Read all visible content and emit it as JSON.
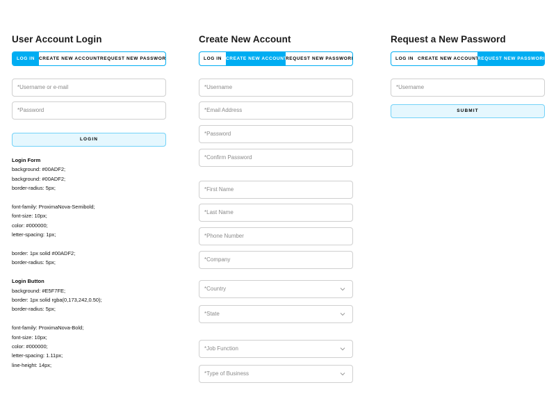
{
  "login": {
    "title": "User Account Login",
    "tabs": [
      "LOG IN",
      "CREATE NEW ACCOUNT",
      "REQUEST NEW PASSWORD"
    ],
    "active_tab": 0,
    "fields": {
      "username": "*Username or e-mail",
      "password": "*Password"
    },
    "button": "LOGIN",
    "notes": {
      "form_heading": "Login Form",
      "form_lines_1": [
        "background: #00ADF2;",
        "background: #00ADF2;",
        "border-radius: 5px;"
      ],
      "form_lines_2": [
        "font-family: ProximaNova-Semibold;",
        "font-size: 10px;",
        "color: #000000;",
        "letter-spacing: 1px;"
      ],
      "form_lines_3": [
        "border: 1px solid #00ADF2;",
        "border-radius: 5px;"
      ],
      "button_heading": "Login Button",
      "button_lines_1": [
        "background: #E5F7FE;",
        "border: 1px solid rgba(0,173,242,0.50);",
        "border-radius: 5px;"
      ],
      "button_lines_2": [
        "font-family: ProximaNova-Bold;",
        "font-size: 10px;",
        "color: #000000;",
        "letter-spacing: 1.11px;",
        "line-height: 14px;"
      ]
    }
  },
  "create": {
    "title": "Create New Account",
    "tabs": [
      "LOG IN",
      "CREATE NEW ACCOUNT",
      "REQUEST NEW PASSWORD"
    ],
    "active_tab": 1,
    "fields": {
      "username": "*Username",
      "email": "*Email Address",
      "password": "*Password",
      "confirm_password": "*Confirm Password",
      "first_name": "*First Name",
      "last_name": "*Last Name",
      "phone": "*Phone Number",
      "company": "*Company",
      "country": "*Country",
      "state": "*State",
      "job_function": "*Job Function",
      "business_type": "*Type of Business"
    }
  },
  "reset": {
    "title": "Request a New Password",
    "tabs": [
      "LOG IN",
      "CREATE NEW ACCOUNT",
      "REQUEST NEW PASSWORD"
    ],
    "active_tab": 2,
    "fields": {
      "username": "*Username"
    },
    "button": "SUBMIT"
  },
  "colors": {
    "accent": "#00ADF2",
    "button_bg": "#E5F7FE",
    "field_border": "#cfcfcf",
    "placeholder": "#8a8a8a"
  },
  "icons": {
    "dropdown": "chevron-down-icon"
  }
}
